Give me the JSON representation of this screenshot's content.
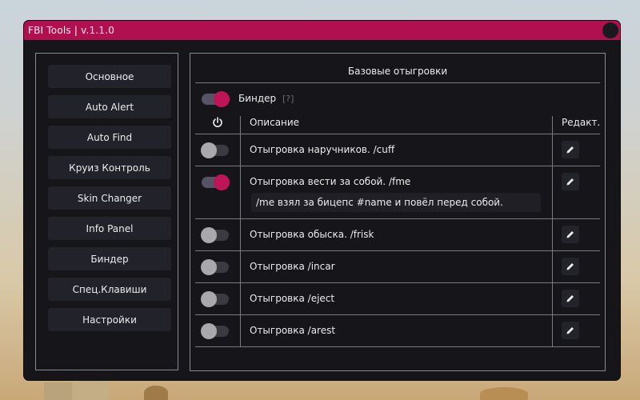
{
  "window": {
    "title": "FBI Tools | v.1.1.0",
    "accent_color": "#b01050"
  },
  "sidebar": {
    "items": [
      {
        "label": "Основное"
      },
      {
        "label": "Auto Alert"
      },
      {
        "label": "Auto Find"
      },
      {
        "label": "Круиз Контроль"
      },
      {
        "label": "Skin Changer"
      },
      {
        "label": "Info Panel"
      },
      {
        "label": "Биндер"
      },
      {
        "label": "Спец.Клавиши"
      },
      {
        "label": "Настройки"
      }
    ]
  },
  "main": {
    "section_title": "Базовые отыгровки",
    "binder": {
      "label": "Биндер",
      "hint": "[?]",
      "enabled": true
    },
    "table": {
      "header_power_icon": "power-icon",
      "header_description": "Описание",
      "header_edit": "Редакт.",
      "rows": [
        {
          "label": "Отыгровка наручников. /cuff",
          "enabled": false,
          "edit_icon": "pencil-icon"
        },
        {
          "label": "Отыгровка вести за собой. /fme",
          "enabled": true,
          "edit_icon": "pencil-icon",
          "detail": "/me взял за бицепс #name и повёл перед собой."
        },
        {
          "label": "Отыгровка обыска. /frisk",
          "enabled": false,
          "edit_icon": "pencil-icon"
        },
        {
          "label": "Отыгровка /incar",
          "enabled": false,
          "edit_icon": "pencil-icon"
        },
        {
          "label": "Отыгровка /eject",
          "enabled": false,
          "edit_icon": "pencil-icon"
        },
        {
          "label": "Отыгровка /arest",
          "enabled": false,
          "edit_icon": "pencil-icon"
        }
      ]
    }
  }
}
